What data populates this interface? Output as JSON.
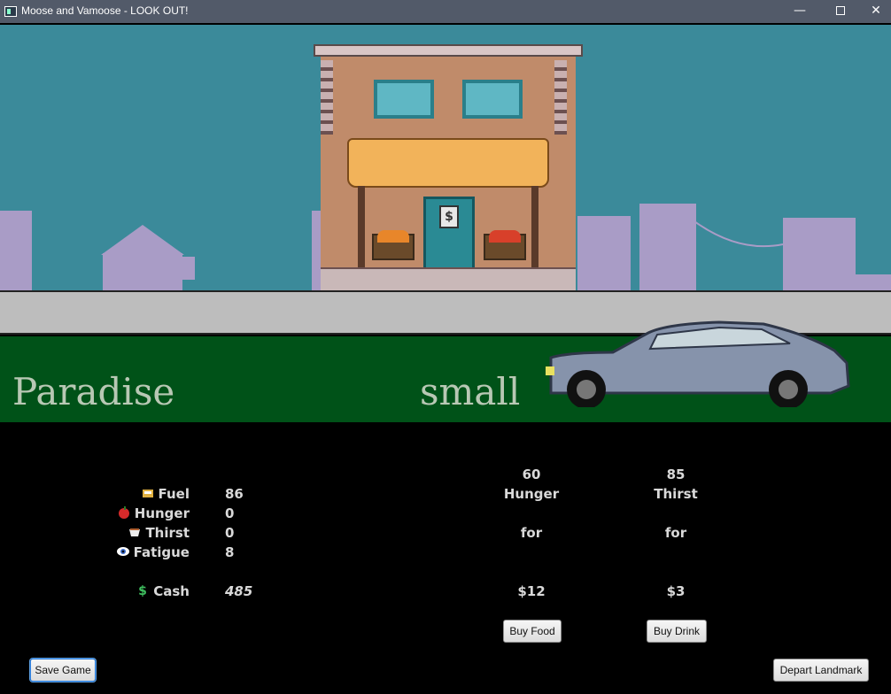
{
  "window": {
    "title": "Moose and Vamoose - LOOK OUT!",
    "min_glyph": "—",
    "close_glyph": "✕"
  },
  "scene": {
    "location_name": "Paradise",
    "location_size": "small",
    "shop_sign": "$",
    "colors": {
      "sky": "#3b8a9a",
      "grass": "#005218",
      "sidewalk": "#bdbdbd",
      "buildings": "#a99cc6",
      "store_wall": "#c08b6a",
      "awning": "#f2b35a",
      "car": "#8693ab"
    }
  },
  "stats": [
    {
      "icon": "fuel-icon",
      "label": "Fuel",
      "value": "86"
    },
    {
      "icon": "apple-icon",
      "label": "Hunger",
      "value": "0"
    },
    {
      "icon": "cup-icon",
      "label": "Thirst",
      "value": "0"
    },
    {
      "icon": "eye-icon",
      "label": "Fatigue",
      "value": "8"
    },
    {
      "icon": "dollar-icon",
      "label": "Cash",
      "value": "485"
    }
  ],
  "shop": {
    "food": {
      "amount": "60",
      "label": "Hunger",
      "for_text": "for",
      "price": "$12",
      "button": "Buy Food"
    },
    "drink": {
      "amount": "85",
      "label": "Thirst",
      "for_text": "for",
      "price": "$3",
      "button": "Buy Drink"
    }
  },
  "buttons": {
    "save": "Save Game",
    "depart": "Depart Landmark"
  }
}
